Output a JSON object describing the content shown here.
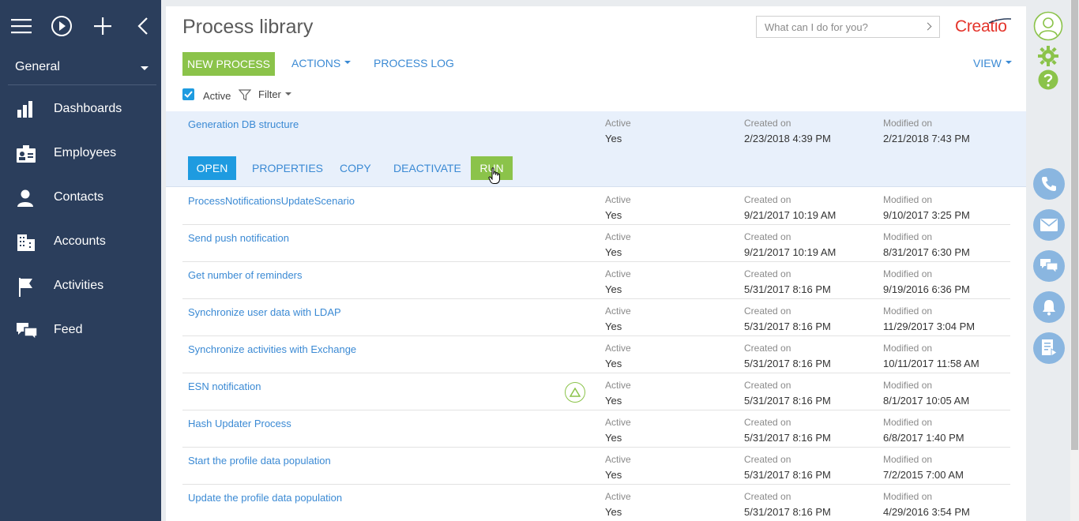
{
  "sidebar": {
    "section": "General",
    "items": [
      {
        "label": "Dashboards",
        "icon": "dashboards-icon"
      },
      {
        "label": "Employees",
        "icon": "employees-icon"
      },
      {
        "label": "Contacts",
        "icon": "contacts-icon"
      },
      {
        "label": "Accounts",
        "icon": "accounts-icon"
      },
      {
        "label": "Activities",
        "icon": "activities-icon"
      },
      {
        "label": "Feed",
        "icon": "feed-icon"
      }
    ]
  },
  "header": {
    "title": "Process library",
    "search_placeholder": "What can I do for you?",
    "logo": "Creatio"
  },
  "toolbar": {
    "new_process": "NEW PROCESS",
    "actions": "ACTIONS",
    "process_log": "PROCESS LOG",
    "view": "VIEW"
  },
  "filters": {
    "active_label": "Active",
    "filter_label": "Filter"
  },
  "row_actions": {
    "open": "OPEN",
    "properties": "PROPERTIES",
    "copy": "COPY",
    "deactivate": "DEACTIVATE",
    "run": "RUN"
  },
  "captions": {
    "active": "Active",
    "created": "Created on",
    "modified": "Modified on"
  },
  "rows": [
    {
      "name": "Generation DB structure",
      "active": "Yes",
      "created": "2/23/2018 4:39 PM",
      "modified": "2/21/2018 7:43 PM"
    },
    {
      "name": "ProcessNotificationsUpdateScenario",
      "active": "Yes",
      "created": "9/21/2017 10:19 AM",
      "modified": "9/10/2017 3:25 PM"
    },
    {
      "name": "Send push notification",
      "active": "Yes",
      "created": "9/21/2017 10:19 AM",
      "modified": "8/31/2017 6:30 PM"
    },
    {
      "name": "Get number of reminders",
      "active": "Yes",
      "created": "5/31/2017 8:16 PM",
      "modified": "9/19/2016 6:36 PM"
    },
    {
      "name": "Synchronize user data with LDAP",
      "active": "Yes",
      "created": "5/31/2017 8:16 PM",
      "modified": "11/29/2017 3:04 PM"
    },
    {
      "name": "Synchronize activities with Exchange",
      "active": "Yes",
      "created": "5/31/2017 8:16 PM",
      "modified": "10/11/2017 11:58 AM"
    },
    {
      "name": "ESN notification",
      "active": "Yes",
      "created": "5/31/2017 8:16 PM",
      "modified": "8/1/2017 10:05 AM"
    },
    {
      "name": "Hash Updater Process",
      "active": "Yes",
      "created": "5/31/2017 8:16 PM",
      "modified": "6/8/2017 1:40 PM"
    },
    {
      "name": "Start the profile data population",
      "active": "Yes",
      "created": "5/31/2017 8:16 PM",
      "modified": "7/2/2015 7:00 AM"
    },
    {
      "name": "Update the profile data population",
      "active": "Yes",
      "created": "5/31/2017 8:16 PM",
      "modified": "4/29/2016 3:54 PM"
    }
  ],
  "colors": {
    "sidebar": "#2b3e5c",
    "accent_blue": "#1e9be0",
    "accent_green": "#8bc34a",
    "link": "#3b8ad4",
    "logo": "#e4342b"
  }
}
